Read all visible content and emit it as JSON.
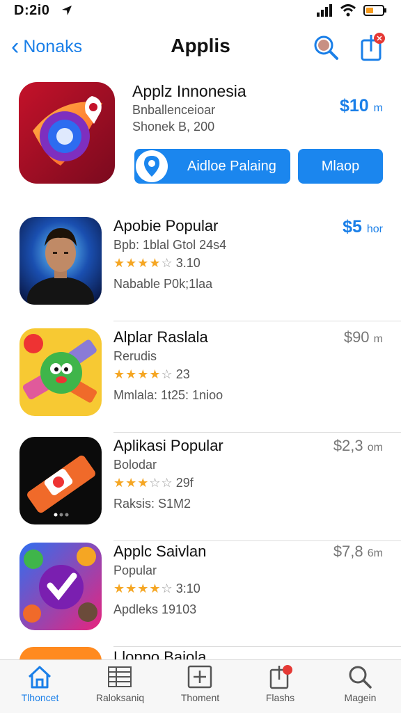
{
  "status": {
    "time": "D:2i0"
  },
  "nav": {
    "back_label": "Nonaks",
    "title": "Applis"
  },
  "featured": {
    "title": "Applz Innonesia",
    "subtitle": "Bnballenceioar",
    "meta": "Shonek B, 200",
    "price": "$10",
    "price_unit": "m",
    "primary_button": "Aidloe Palaing",
    "secondary_button": "Mlaop"
  },
  "apps": [
    {
      "title": "Apobie Popular",
      "subtitle": "Bpb: 1blal  Gtol 24s4",
      "stars": 4,
      "rating": "3.10",
      "meta": "Nabable P0k;1laa",
      "price": "$5",
      "price_unit": "hor",
      "price_blue": true
    },
    {
      "title": "Alplar Raslala",
      "subtitle": "Rerudis",
      "stars": 4,
      "rating": "23",
      "meta": "Mmlala: 1t25: 1nioo",
      "price": "$90",
      "price_unit": "m",
      "price_blue": false
    },
    {
      "title": "Aplikasi Popular",
      "subtitle": "Bolodar",
      "stars": 3,
      "rating": "29f",
      "meta": "Raksis: S1M2",
      "price": "$2,3",
      "price_unit": "om",
      "price_blue": false
    },
    {
      "title": "Applc Saivlan",
      "subtitle": "Popular",
      "stars": 4,
      "rating": "3:10",
      "meta": "Apdleks 19103",
      "price": "$7,8",
      "price_unit": "6m",
      "price_blue": false
    }
  ],
  "partial": {
    "title": "Lloppo Baiola"
  },
  "tabs": [
    {
      "label": "Tlhoncet",
      "icon": "home-icon",
      "active": true
    },
    {
      "label": "Raloksaniq",
      "icon": "list-icon",
      "active": false
    },
    {
      "label": "Thoment",
      "icon": "plus-box-icon",
      "active": false
    },
    {
      "label": "Flashs",
      "icon": "share-icon",
      "active": false
    },
    {
      "label": "Magein",
      "icon": "search-icon",
      "active": false
    }
  ],
  "colors": {
    "accent": "#1a7fe8",
    "star": "#f5a623",
    "badge": "#e53935"
  }
}
